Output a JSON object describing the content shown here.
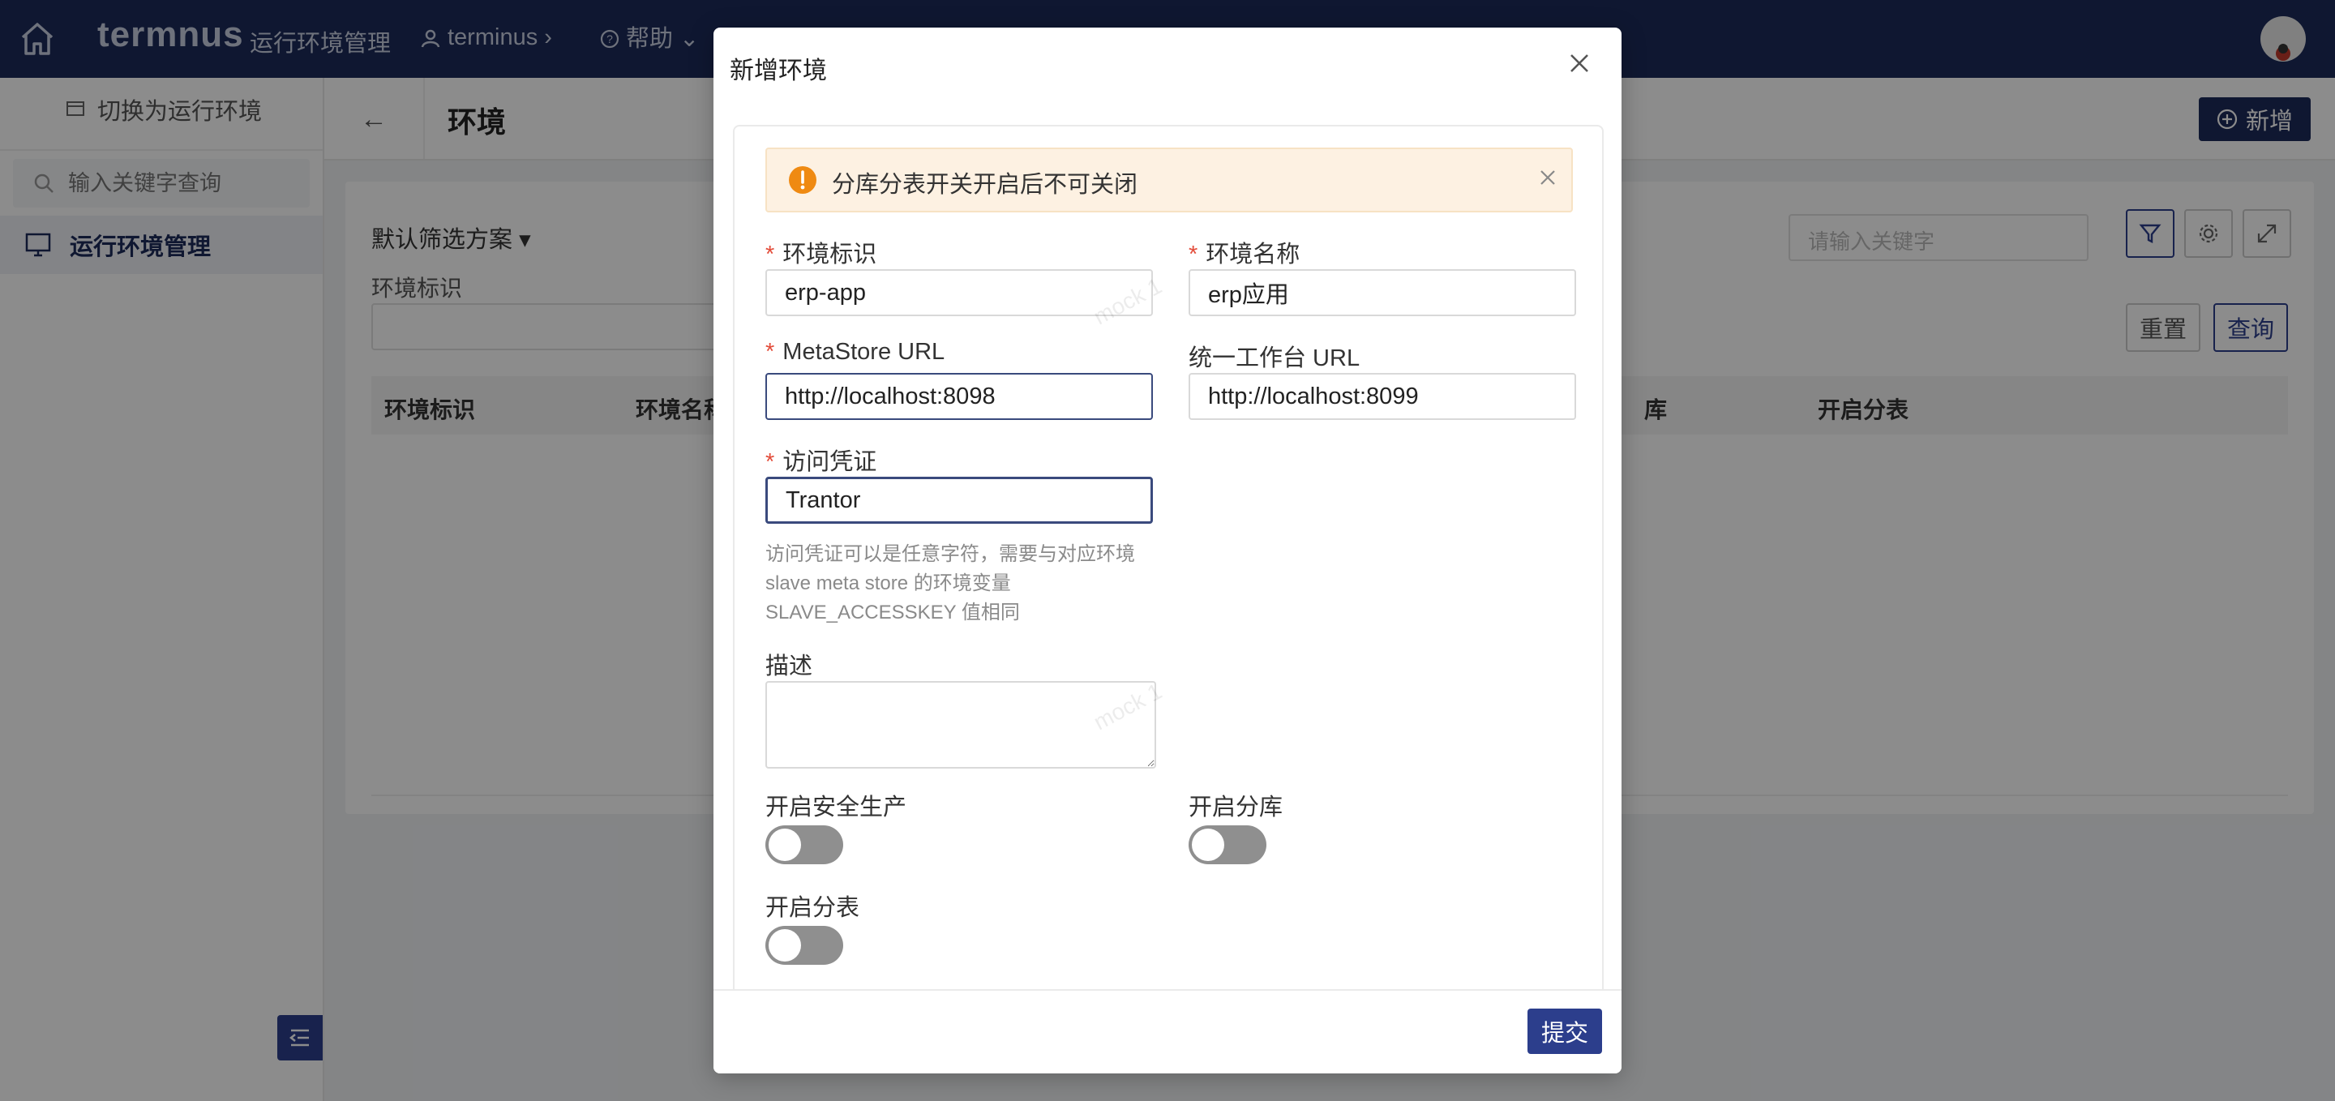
{
  "topbar": {
    "logo": "termnus",
    "nav_title": "运行环境管理",
    "user": "terminus",
    "help": "帮助"
  },
  "sidebar": {
    "switch_label": "切换为运行环境",
    "search_placeholder": "输入关键字查询",
    "menu_item": "运行环境管理"
  },
  "page": {
    "back": "←",
    "title": "环境",
    "add_button": "新增",
    "filter_scheme": "默认筛选方案",
    "filter_label": "环境标识",
    "keyword_placeholder": "请输入关键字",
    "reset_button": "重置",
    "query_button": "查询",
    "columns": [
      "环境标识",
      "环境名称",
      "库",
      "开启分表"
    ]
  },
  "modal": {
    "title": "新增环境",
    "alert": "分库分表开关开启后不可关闭",
    "fields": {
      "env_id_label": "环境标识",
      "env_id_value": "erp-app",
      "env_name_label": "环境名称",
      "env_name_value": "erp应用",
      "metastore_label": "MetaStore URL",
      "metastore_value": "http://localhost:8098",
      "workbench_label": "统一工作台 URL",
      "workbench_value": "http://localhost:8099",
      "credential_label": "访问凭证",
      "credential_value": "Trantor",
      "credential_help": "访问凭证可以是任意字符，需要与对应环境 slave meta store 的环境变量 SLAVE_ACCESSKEY 值相同",
      "desc_label": "描述",
      "desc_value": "",
      "safe_prod_label": "开启安全生产",
      "sharding_db_label": "开启分库",
      "sharding_table_label": "开启分表"
    },
    "submit": "提交"
  },
  "watermark": "mock 1"
}
